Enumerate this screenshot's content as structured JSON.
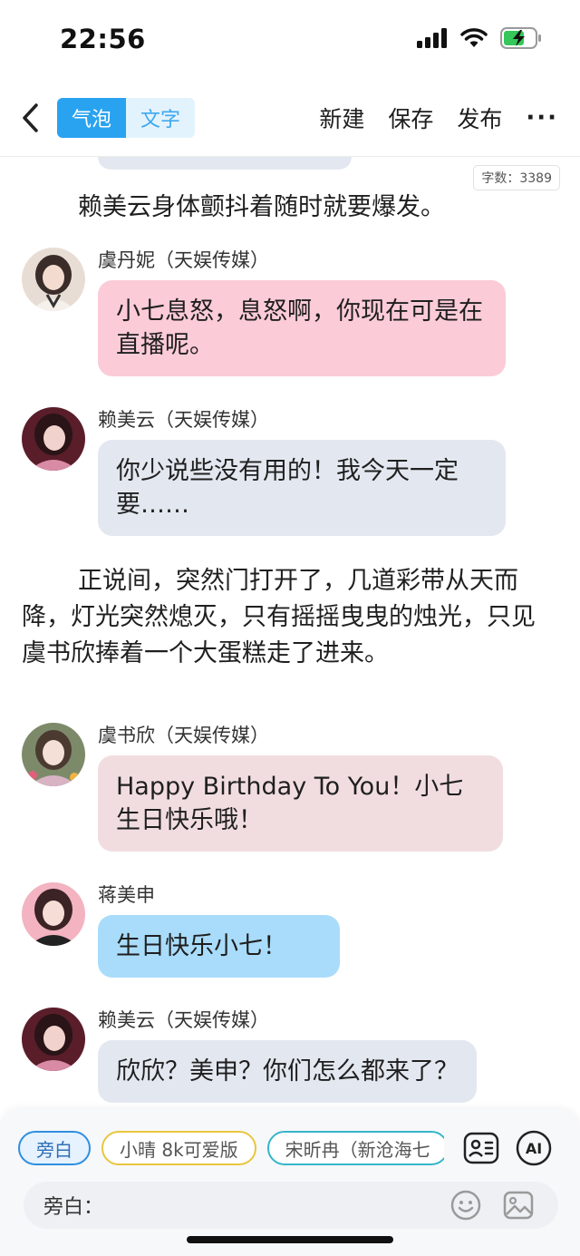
{
  "status_bar": {
    "time": "22:56",
    "icons": [
      "signal-icon",
      "wifi-icon",
      "battery-charging-icon"
    ]
  },
  "nav": {
    "back_icon": "back-chevron-icon",
    "segments": [
      "气泡",
      "文字"
    ],
    "active_segment": "气泡",
    "actions": [
      "新建",
      "保存",
      "发布"
    ],
    "more": "···"
  },
  "content": {
    "word_count": "字数：3389",
    "narration_1": "赖美云身体颤抖着随时就要爆发。",
    "messages": [
      {
        "sender": "虞丹妮（天娱传媒）",
        "text": "小七息怒，息怒啊，你现在可是在直播呢。",
        "bubble_color": "#fccbd8"
      },
      {
        "sender": "赖美云（天娱传媒）",
        "text": "你少说些没有用的！我今天一定要……",
        "bubble_color": "#e3e8f0"
      },
      {
        "sender": "虞书欣（天娱传媒）",
        "text": "Happy Birthday To You！小七生日快乐哦！",
        "bubble_color": "#f1dde0"
      },
      {
        "sender": "蒋美申",
        "text": "生日快乐小七！",
        "bubble_color": "#a9dcfb"
      },
      {
        "sender": "赖美云（天娱传媒）",
        "text": "欣欣？美申？你们怎么都来了？",
        "bubble_color": "#e3e8f0"
      }
    ],
    "narration_2": "正说间，突然门打开了，几道彩带从天而降，灯光突然熄灭，只有摇摇曳曳的烛光，只见虞书欣捧着一个大蛋糕走了进来。"
  },
  "bottom": {
    "roles": [
      "旁白",
      "小晴 8k可爱版",
      "宋昕冉（新沧海七"
    ],
    "selected_role": "旁白",
    "input_prefix": "旁白：",
    "icons": [
      "contact-card-icon",
      "ai-icon",
      "emoji-icon",
      "image-icon"
    ]
  }
}
